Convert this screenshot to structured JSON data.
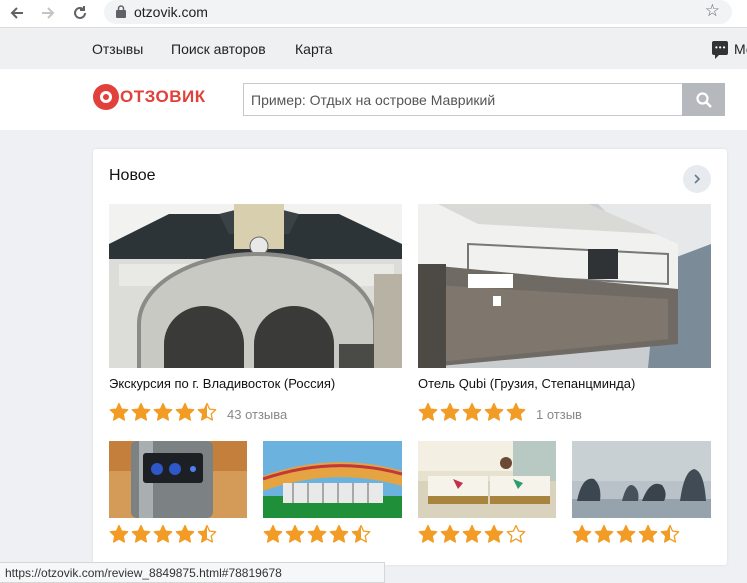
{
  "browser": {
    "url": "otzovik.com",
    "back_icon": "arrow-left-icon",
    "forward_icon": "arrow-right-icon",
    "reload_icon": "reload-icon",
    "bookmark_icon": "star-outline-icon"
  },
  "topnav": {
    "items": [
      "Отзывы",
      "Поиск авторов",
      "Карта"
    ],
    "messages_label": "Ме"
  },
  "header": {
    "logo_text": "ОТЗОВИК",
    "search_placeholder": "Пример: Отдых на острове Маврикий"
  },
  "colors": {
    "brand": "#e2403b",
    "star": "#f39c25",
    "star_empty": "#f39c25"
  },
  "section": {
    "title": "Новое",
    "items": [
      {
        "title": "Экскурсия по г. Владивосток (Россия)",
        "rating": 4.5,
        "count": "43 отзыва",
        "image": "vladivostok-station-photo"
      },
      {
        "title": "Отель Qubi (Грузия, Степанцминда)",
        "rating": 5,
        "count": "1 отзыв",
        "image": "hotel-qubi-photo"
      },
      {
        "rating": 4.5,
        "image": "appliance-photo"
      },
      {
        "rating": 4.5,
        "image": "stadium-photo"
      },
      {
        "rating": 4,
        "image": "hotel-room-photo"
      },
      {
        "rating": 4.5,
        "image": "halong-bay-photo"
      }
    ]
  },
  "status_bar": "https://otzovik.com/review_8849875.html#78819678"
}
